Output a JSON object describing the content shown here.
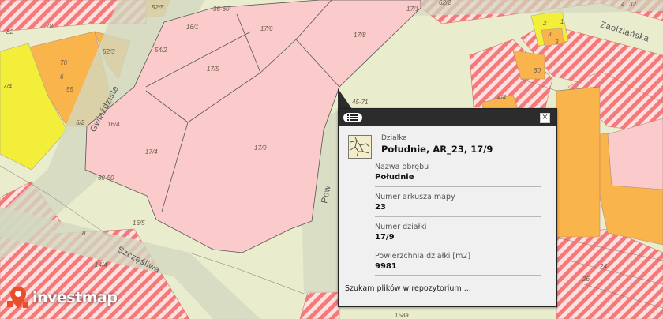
{
  "map": {
    "parcel_labels": [
      "17/6",
      "17/8",
      "17/5",
      "17/4",
      "17/9",
      "17/1",
      "16/1",
      "16/4",
      "16/5",
      "52/3",
      "52/5",
      "54/2",
      "36-60",
      "60-50",
      "45-71",
      "5/2",
      "76",
      "55",
      "6",
      "8",
      "82",
      "78",
      "7/4",
      "3",
      "4/4",
      "60",
      "14/4",
      "24",
      "26",
      "32",
      "4",
      "2",
      "3",
      "1",
      "158a",
      "62/2"
    ],
    "street_names": [
      "Gwiaździsta",
      "Szczęśliwa",
      "Zaolziańska",
      "Pow"
    ],
    "colors": {
      "background": "#e9eccd",
      "parcel_pink": "#fbcaca",
      "hatch_red": "#f47a7a",
      "orange": "#f9b44c",
      "yellow": "#f2ee3a",
      "road": "#d2d8c0"
    }
  },
  "popup": {
    "type_label": "Działka",
    "title": "Południe, AR_23, 17/9",
    "fields": [
      {
        "label": "Nazwa obrębu",
        "value": "Południe"
      },
      {
        "label": "Numer arkusza mapy",
        "value": "23"
      },
      {
        "label": "Numer działki",
        "value": "17/9"
      },
      {
        "label": "Powierzchnia działki [m2]",
        "value": "9981"
      }
    ],
    "status": "Szukam plików w repozytorium ...",
    "icons": {
      "list": "list-icon",
      "close": "close-icon",
      "parcel": "parcel-map-icon"
    },
    "header_color": "#2c2c2c"
  },
  "logo": {
    "text": "investmap",
    "color": "#e8502a"
  }
}
